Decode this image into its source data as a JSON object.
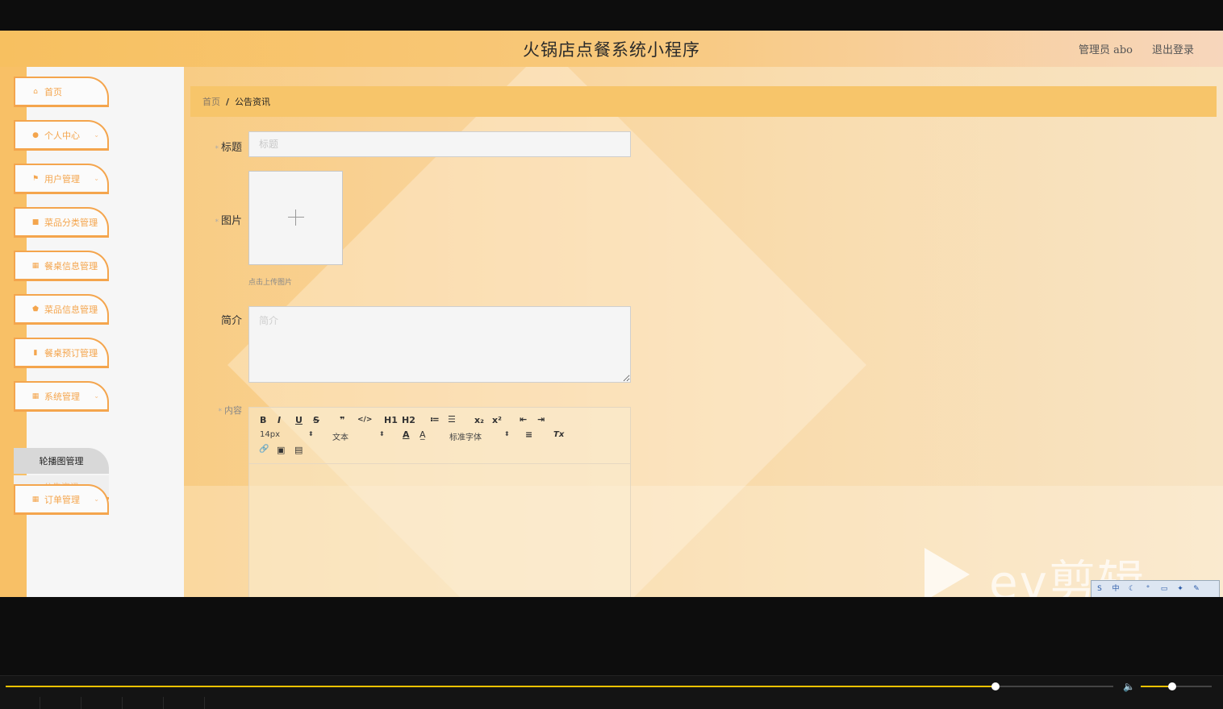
{
  "app": {
    "title": "火锅店点餐系统小程序",
    "user_info": "管理员  abo",
    "logout": "退出登录"
  },
  "sidebar": {
    "items": [
      {
        "label": "首页",
        "icon": "home-icon",
        "glyph": "⌂"
      },
      {
        "label": "个人中心",
        "icon": "user-icon",
        "glyph": "●"
      },
      {
        "label": "用户管理",
        "icon": "flag-icon",
        "glyph": "⚑"
      },
      {
        "label": "菜品分类管理",
        "icon": "folder-icon",
        "glyph": "■"
      },
      {
        "label": "餐桌信息管理",
        "icon": "table-icon",
        "glyph": "▦"
      },
      {
        "label": "菜品信息管理",
        "icon": "shield-icon",
        "glyph": "⬟"
      },
      {
        "label": "餐桌预订管理",
        "icon": "bar-chart-icon",
        "glyph": "▮"
      },
      {
        "label": "系统管理",
        "icon": "grid-icon",
        "glyph": "▦"
      },
      {
        "label": "订单管理",
        "icon": "grid-icon",
        "glyph": "▦"
      }
    ],
    "submenu": {
      "active": "轮播图管理",
      "item": "公告资讯"
    }
  },
  "breadcrumb": {
    "home": "首页",
    "separator": "/",
    "current": "公告资讯"
  },
  "form": {
    "title_label": "标题",
    "title_placeholder": "标题",
    "image_label": "图片",
    "upload_tip": "点击上传图片",
    "intro_label": "简介",
    "intro_placeholder": "简介",
    "content_label": "内容",
    "required_mark": "*"
  },
  "editor": {
    "toolbar_row1": [
      "B",
      "I",
      "U",
      "S",
      "❞",
      "</>",
      "H1",
      "H2",
      "≔",
      "☰",
      "x₂",
      "x²",
      "⇤",
      "⇥"
    ],
    "font_size": "14px",
    "block_type": "文本",
    "font_family": "标准字体",
    "select_arrow": "⬍",
    "color_icon": "A",
    "bg_icon": "A̲",
    "align_icon": "≡",
    "clear_icon": "Tx",
    "toolbar_row3": [
      "🔗",
      "▣",
      "▤"
    ]
  },
  "watermark": {
    "text": "ev剪辑"
  },
  "player": {
    "progress": 0.894,
    "volume": 0.44,
    "volume_icon": "🔈"
  },
  "colors": {
    "accent": "#f4a54d",
    "breadcrumb_bg": "#f7c56a",
    "seek": "#f2c200"
  }
}
